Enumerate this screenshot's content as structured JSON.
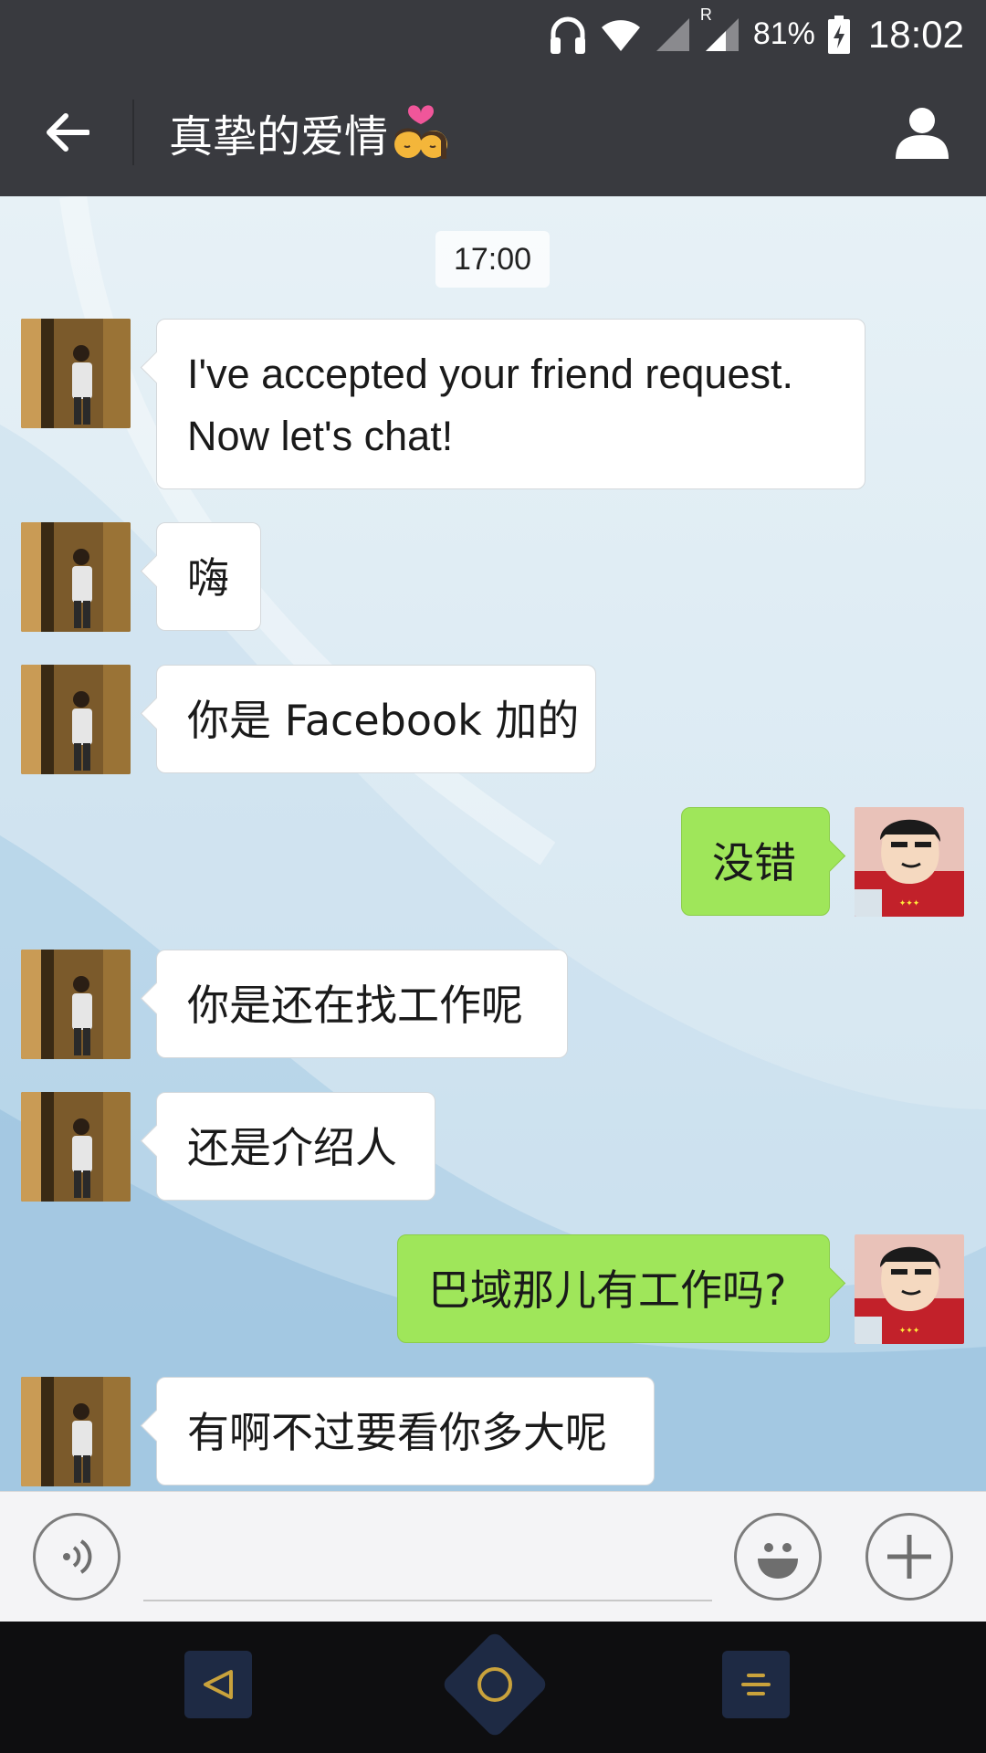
{
  "status_bar": {
    "battery": "81%",
    "time": "18:02",
    "roaming_label": "R"
  },
  "header": {
    "title": "真挚的爱情",
    "title_emoji": "couple-kiss-emoji"
  },
  "chat": {
    "timestamp": "17:00",
    "messages": [
      {
        "side": "in",
        "text": "I've accepted your friend request. Now let's chat!"
      },
      {
        "side": "in",
        "text": "嗨"
      },
      {
        "side": "in",
        "text": "你是 Facebook 加的"
      },
      {
        "side": "out",
        "text": "没错"
      },
      {
        "side": "in",
        "text": "你是还在找工作呢"
      },
      {
        "side": "in",
        "text": "还是介绍人"
      },
      {
        "side": "out",
        "text": "巴域那儿有工作吗?"
      },
      {
        "side": "in",
        "text": "有啊不过要看你多大呢"
      }
    ]
  },
  "input": {
    "value": "",
    "placeholder": ""
  },
  "colors": {
    "header_bg": "#393a3f",
    "outgoing_bubble": "#9fe65a",
    "incoming_bubble": "#ffffff",
    "nav_accent": "#c9a23c"
  },
  "icons": {
    "back": "arrow-left-icon",
    "profile": "person-icon",
    "voice": "voice-icon",
    "emoji": "smiley-icon",
    "plus": "plus-icon",
    "nav_back": "triangle-back-icon",
    "nav_home": "circle-home-icon",
    "nav_menu": "menu-lines-icon"
  }
}
